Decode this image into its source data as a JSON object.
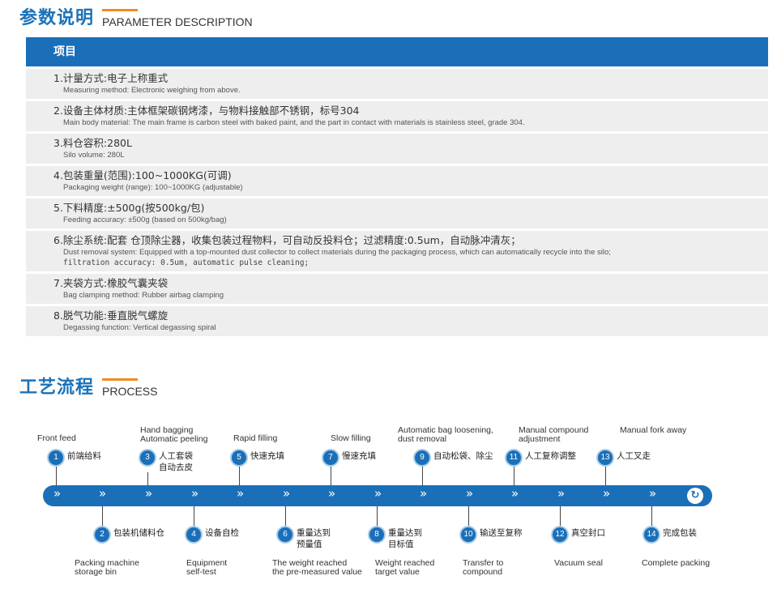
{
  "params": {
    "title_cn": "参数说明",
    "title_en": "PARAMETER DESCRIPTION",
    "header": "项目",
    "rows": [
      {
        "cn": "1.计量方式:电子上称重式",
        "en": "Measuring method: Electronic weighing from above."
      },
      {
        "cn": "2.设备主体材质:主体框架碳钢烤漆，与物料接触部不锈钢，标号304",
        "en": "Main body material: The main frame is carbon steel with baked paint, and the part in contact with materials is stainless steel, grade 304."
      },
      {
        "cn": "3.料仓容积:280L",
        "en": "Silo volume: 280L"
      },
      {
        "cn": "4.包装重量(范围):100~1000KG(可调)",
        "en": "Packaging weight (range): 100~1000KG (adjustable)"
      },
      {
        "cn": "5.下料精度:±500g(按500kg/包)",
        "en": "Feeding accuracy: ±500g (based on 500kg/bag)"
      },
      {
        "cn": "6.除尘系统:配套 仓顶除尘器，收集包装过程物料，可自动反投料仓；过滤精度:0.5um，自动脉冲清灰；",
        "en": "Dust removal system: Equipped with a top-mounted dust collector to collect materials during the packaging process, which can automatically recycle into the silo;",
        "en2": "filtration accuracy: 0.5um, automatic pulse cleaning;"
      },
      {
        "cn": "7.夹袋方式:橡胶气囊夹袋",
        "en": "Bag clamping method: Rubber airbag clamping"
      },
      {
        "cn": "8.脱气功能:垂直脱气螺旋",
        "en": "Degassing function: Vertical degassing spiral"
      }
    ]
  },
  "process": {
    "title_cn": "工艺流程",
    "title_en": "PROCESS",
    "cycle_icon": "cycle-icon",
    "arrow_glyph": "»",
    "steps": [
      {
        "num": "1",
        "cn": "前端给料",
        "en": "Front feed"
      },
      {
        "num": "2",
        "cn": "包装机储料仓",
        "en": "Packing machine\nstorage bin"
      },
      {
        "num": "3",
        "cn": "人工套袋\n自动去皮",
        "en": "Hand bagging\nAutomatic peeling"
      },
      {
        "num": "4",
        "cn": "设备自检",
        "en": "Equipment\nself-test"
      },
      {
        "num": "5",
        "cn": "快速充填",
        "en": "Rapid filling"
      },
      {
        "num": "6",
        "cn": "重量达到\n预量值",
        "en": "The weight reached\nthe pre-measured value"
      },
      {
        "num": "7",
        "cn": "慢速充填",
        "en": "Slow filling"
      },
      {
        "num": "8",
        "cn": "重量达到\n目标值",
        "en": "Weight reached\ntarget value"
      },
      {
        "num": "9",
        "cn": "自动松袋、除尘",
        "en": "Automatic bag loosening,\ndust removal"
      },
      {
        "num": "10",
        "cn": "输送至复称",
        "en": "Transfer to\ncompound"
      },
      {
        "num": "11",
        "cn": "人工复称调整",
        "en": "Manual compound\nadjustment"
      },
      {
        "num": "12",
        "cn": "真空封口",
        "en": "Vacuum seal"
      },
      {
        "num": "13",
        "cn": "人工叉走",
        "en": "Manual fork away"
      },
      {
        "num": "14",
        "cn": "完成包装",
        "en": "Complete packing"
      }
    ]
  }
}
